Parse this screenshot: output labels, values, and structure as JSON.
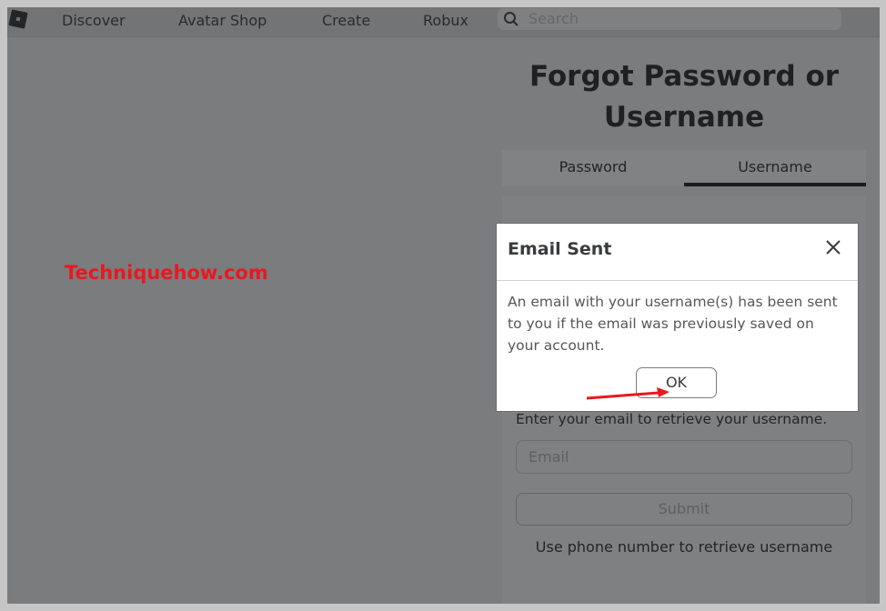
{
  "topbar": {
    "logo_icon": "roblox-logo-icon",
    "nav": [
      "Discover",
      "Avatar Shop",
      "Create",
      "Robux"
    ],
    "search_placeholder": "Search"
  },
  "page": {
    "title_line1": "Forgot Password or",
    "title_line2": "Username",
    "tabs": [
      {
        "label": "Password",
        "active": false
      },
      {
        "label": "Username",
        "active": true
      }
    ],
    "hint": "Enter your email to retrieve your username.",
    "email_placeholder": "Email",
    "submit_label": "Submit",
    "phone_link": "Use phone number to retrieve username"
  },
  "watermark": "Techniquehow.com",
  "modal": {
    "title": "Email Sent",
    "body": "An email with your username(s) has been sent to you if the email was previously saved on your account.",
    "ok_label": "OK",
    "close_icon": "close-icon"
  },
  "colors": {
    "watermark": "#e8191f",
    "arrow": "#e8191f",
    "overlay_bg": "#7b7c7e"
  }
}
